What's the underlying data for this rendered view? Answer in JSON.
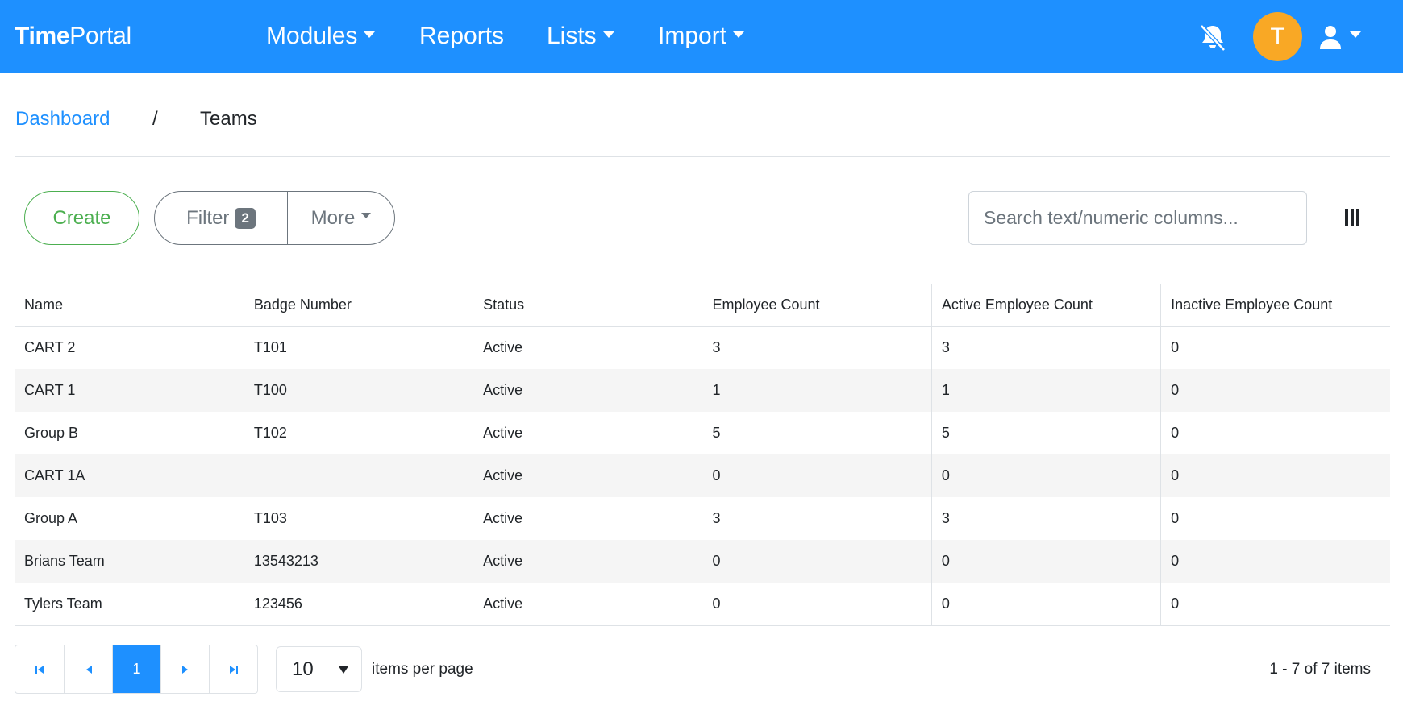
{
  "navbar": {
    "brand_bold": "Time",
    "brand_light": "Portal",
    "items": [
      {
        "label": "Modules",
        "dropdown": true
      },
      {
        "label": "Reports",
        "dropdown": false
      },
      {
        "label": "Lists",
        "dropdown": true
      },
      {
        "label": "Import",
        "dropdown": true
      }
    ],
    "avatar_initial": "T",
    "colors": {
      "bar": "#1e90ff",
      "avatar": "#f9a825"
    },
    "icons": [
      "bell-slash-icon",
      "user-icon"
    ]
  },
  "breadcrumb": {
    "link": "Dashboard",
    "separator": "/",
    "current": "Teams"
  },
  "toolbar": {
    "create_label": "Create",
    "filter_label": "Filter",
    "filter_count": "2",
    "more_label": "More",
    "search_placeholder": "Search text/numeric columns...",
    "colors": {
      "create": "#4caf50",
      "outline": "#6c757d"
    }
  },
  "table": {
    "columns": [
      "Name",
      "Badge Number",
      "Status",
      "Employee Count",
      "Active Employee Count",
      "Inactive Employee Count"
    ],
    "rows": [
      [
        "CART 2",
        "T101",
        "Active",
        "3",
        "3",
        "0"
      ],
      [
        "CART 1",
        "T100",
        "Active",
        "1",
        "1",
        "0"
      ],
      [
        "Group B",
        "T102",
        "Active",
        "5",
        "5",
        "0"
      ],
      [
        "CART 1A",
        "",
        "Active",
        "0",
        "0",
        "0"
      ],
      [
        "Group A",
        "T103",
        "Active",
        "3",
        "3",
        "0"
      ],
      [
        "Brians Team",
        "13543213",
        "Active",
        "0",
        "0",
        "0"
      ],
      [
        "Tylers Team",
        "123456",
        "Active",
        "0",
        "0",
        "0"
      ]
    ]
  },
  "pager": {
    "current_page": "1",
    "page_size": "10",
    "items_per_page_label": "items per page",
    "info": "1 - 7 of 7 items"
  }
}
